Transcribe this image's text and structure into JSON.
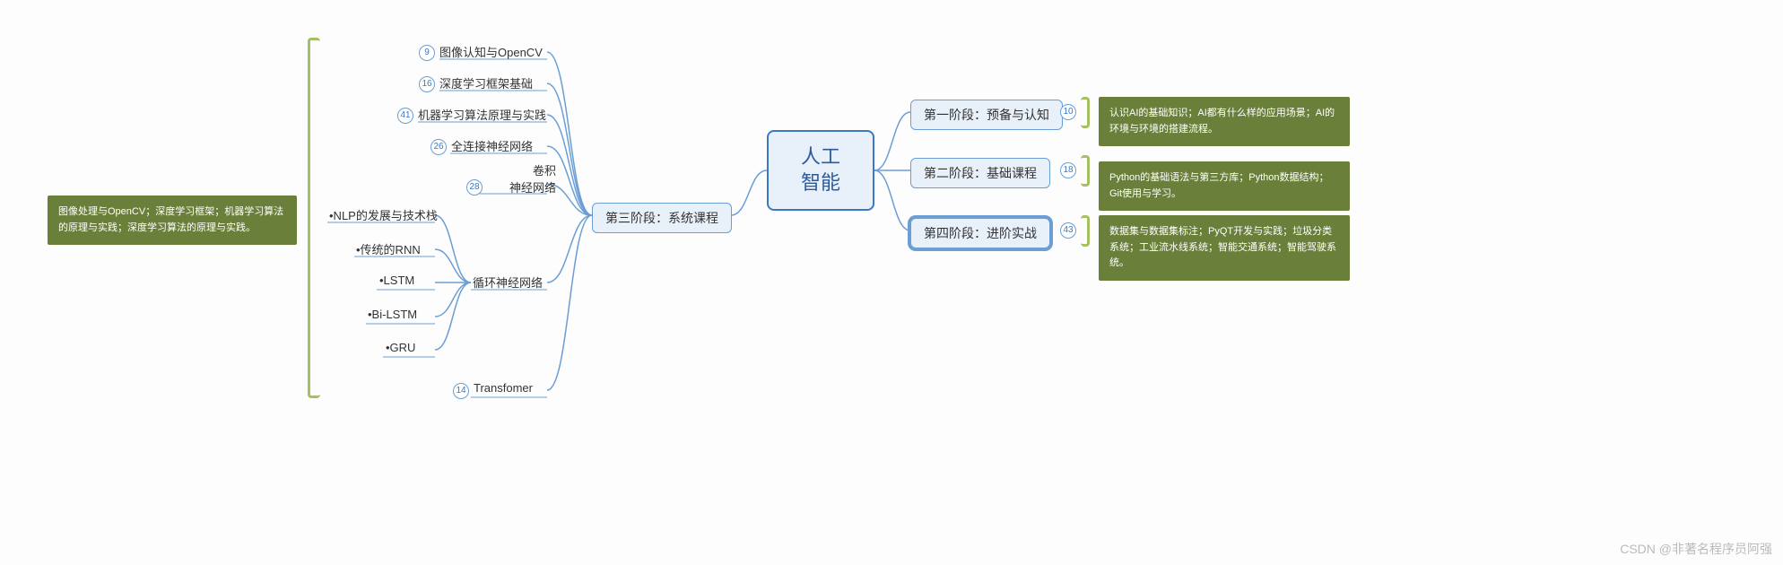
{
  "root": "人工\n智能",
  "stages": {
    "stage1": {
      "label": "第一阶段：预备与认知",
      "count": "10",
      "note": "认识AI的基础知识；AI都有什么样的应用场景；AI的环境与环境的搭建流程。"
    },
    "stage2": {
      "label": "第二阶段：基础课程",
      "count": "18",
      "note": "Python的基础语法与第三方库；Python数据结构；Git使用与学习。"
    },
    "stage3": {
      "label": "第三阶段：系统课程",
      "note": "图像处理与OpenCV；深度学习框架；机器学习算法的原理与实践；深度学习算法的原理与实践。"
    },
    "stage4": {
      "label": "第四阶段：进阶实战",
      "count": "43",
      "note": "数据集与数据集标注；PyQT开发与实践；垃圾分类系统；工业流水线系统；智能交通系统；智能驾驶系统。"
    }
  },
  "stage3_children": {
    "c1": {
      "label": "图像认知与OpenCV",
      "count": "9"
    },
    "c2": {
      "label": "深度学习框架基础",
      "count": "16"
    },
    "c3": {
      "label": "机器学习算法原理与实践",
      "count": "41"
    },
    "c4": {
      "label": "全连接神经网络",
      "count": "26"
    },
    "c5": {
      "label": "卷积\n神经网络",
      "count": "28"
    },
    "c6": {
      "label": "循环神经网络"
    },
    "c7": {
      "label": "Transfomer",
      "count": "14"
    }
  },
  "rnn_children": {
    "r1": "•NLP的发展与技术栈",
    "r2": "•传统的RNN",
    "r3": "•LSTM",
    "r4": "•Bi-LSTM",
    "r5": "•GRU"
  },
  "watermark": "CSDN @非著名程序员阿强"
}
